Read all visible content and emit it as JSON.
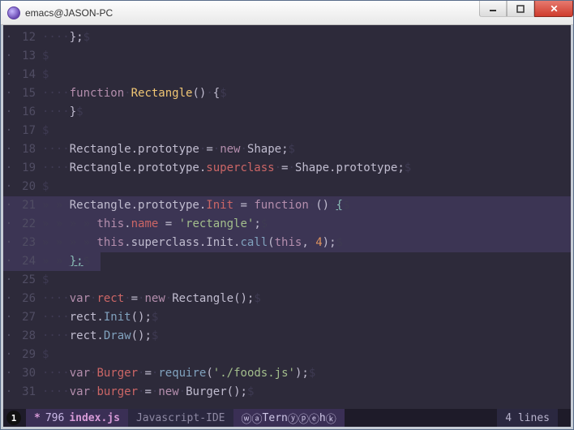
{
  "window": {
    "title": "emacs@JASON-PC"
  },
  "editor": {
    "whitespace_dot": "·",
    "whitespace_tab": "» ",
    "eol_marker": "$",
    "lines": [
      {
        "n": 12,
        "hl": false,
        "tokens": [
          [
            "ws",
            "····"
          ],
          [
            "pun",
            "};"
          ],
          [
            "eol",
            "$"
          ]
        ]
      },
      {
        "n": 13,
        "hl": false,
        "tokens": [
          [
            "eol",
            "$"
          ]
        ]
      },
      {
        "n": 14,
        "hl": false,
        "tokens": [
          [
            "eol",
            "$"
          ]
        ]
      },
      {
        "n": 15,
        "hl": false,
        "tokens": [
          [
            "ws",
            "····"
          ],
          [
            "kw",
            "function"
          ],
          [
            "ws",
            "·"
          ],
          [
            "fn",
            "Rectangle"
          ],
          [
            "pun",
            "()"
          ],
          [
            "ws",
            "·"
          ],
          [
            "pun",
            "{"
          ],
          [
            "eol",
            "$"
          ]
        ]
      },
      {
        "n": 16,
        "hl": false,
        "tokens": [
          [
            "ws",
            "····"
          ],
          [
            "pun",
            "}"
          ],
          [
            "eol",
            "$"
          ]
        ]
      },
      {
        "n": 17,
        "hl": false,
        "tokens": [
          [
            "eol",
            "$"
          ]
        ]
      },
      {
        "n": 18,
        "hl": false,
        "tokens": [
          [
            "ws",
            "····"
          ],
          [
            "id",
            "Rectangle.prototype"
          ],
          [
            "ws",
            "·"
          ],
          [
            "pun",
            "="
          ],
          [
            "ws",
            "·"
          ],
          [
            "kw",
            "new"
          ],
          [
            "ws",
            "·"
          ],
          [
            "id",
            "Shape;"
          ],
          [
            "eol",
            "$"
          ]
        ]
      },
      {
        "n": 19,
        "hl": false,
        "tokens": [
          [
            "ws",
            "····"
          ],
          [
            "id",
            "Rectangle.prototype."
          ],
          [
            "assign-name",
            "superclass"
          ],
          [
            "ws",
            "·"
          ],
          [
            "pun",
            "="
          ],
          [
            "ws",
            "·"
          ],
          [
            "id",
            "Shape.prototype;"
          ],
          [
            "eol",
            "$"
          ]
        ]
      },
      {
        "n": 20,
        "hl": false,
        "tokens": [
          [
            "eol",
            "$"
          ]
        ]
      },
      {
        "n": 21,
        "hl": true,
        "tokens": [
          [
            "ws",
            "» » "
          ],
          [
            "id",
            "Rectangle.prototype."
          ],
          [
            "assign-name",
            "Init"
          ],
          [
            "ws",
            "·"
          ],
          [
            "pun",
            "="
          ],
          [
            "ws",
            "·"
          ],
          [
            "kw",
            "function"
          ],
          [
            "ws",
            "·"
          ],
          [
            "pun",
            "()"
          ],
          [
            "ws",
            "·"
          ],
          [
            "brace-match",
            "{"
          ],
          [
            "eol",
            "$"
          ]
        ]
      },
      {
        "n": 22,
        "hl": true,
        "tokens": [
          [
            "ws",
            "» » » » "
          ],
          [
            "kw",
            "this"
          ],
          [
            "id",
            "."
          ],
          [
            "assign-name",
            "name"
          ],
          [
            "ws",
            "·"
          ],
          [
            "pun",
            "="
          ],
          [
            "ws",
            "·"
          ],
          [
            "str",
            "'rectangle'"
          ],
          [
            "pun",
            ";"
          ],
          [
            "eol",
            "$"
          ]
        ]
      },
      {
        "n": 23,
        "hl": true,
        "tokens": [
          [
            "ws",
            "» » » » "
          ],
          [
            "kw",
            "this"
          ],
          [
            "id",
            ".superclass.Init."
          ],
          [
            "call",
            "call"
          ],
          [
            "pun",
            "("
          ],
          [
            "kw",
            "this"
          ],
          [
            "pun",
            ","
          ],
          [
            "ws",
            "·"
          ],
          [
            "num",
            "4"
          ],
          [
            "pun",
            ");"
          ],
          [
            "eol",
            "$"
          ]
        ]
      },
      {
        "n": 24,
        "hl": "last",
        "tokens": [
          [
            "ws",
            "» » "
          ],
          [
            "brace-match",
            "};"
          ],
          [
            "eol",
            "$"
          ]
        ]
      },
      {
        "n": 25,
        "hl": false,
        "tokens": [
          [
            "eol",
            "$"
          ]
        ]
      },
      {
        "n": 26,
        "hl": false,
        "tokens": [
          [
            "ws",
            "····"
          ],
          [
            "kw",
            "var"
          ],
          [
            "ws",
            "·"
          ],
          [
            "assign-name",
            "rect"
          ],
          [
            "ws",
            "·"
          ],
          [
            "pun",
            "="
          ],
          [
            "ws",
            "·"
          ],
          [
            "kw",
            "new"
          ],
          [
            "ws",
            "·"
          ],
          [
            "id",
            "Rectangle();"
          ],
          [
            "eol",
            "$"
          ]
        ]
      },
      {
        "n": 27,
        "hl": false,
        "tokens": [
          [
            "ws",
            "····"
          ],
          [
            "id",
            "rect."
          ],
          [
            "call",
            "Init"
          ],
          [
            "pun",
            "();"
          ],
          [
            "eol",
            "$"
          ]
        ]
      },
      {
        "n": 28,
        "hl": false,
        "tokens": [
          [
            "ws",
            "····"
          ],
          [
            "id",
            "rect."
          ],
          [
            "call",
            "Draw"
          ],
          [
            "pun",
            "();"
          ],
          [
            "eol",
            "$"
          ]
        ]
      },
      {
        "n": 29,
        "hl": false,
        "tokens": [
          [
            "eol",
            "$"
          ]
        ]
      },
      {
        "n": 30,
        "hl": false,
        "tokens": [
          [
            "ws",
            "····"
          ],
          [
            "kw",
            "var"
          ],
          [
            "ws",
            "·"
          ],
          [
            "assign-name",
            "Burger"
          ],
          [
            "ws",
            "·"
          ],
          [
            "pun",
            "="
          ],
          [
            "ws",
            "·"
          ],
          [
            "call",
            "require"
          ],
          [
            "pun",
            "("
          ],
          [
            "str",
            "'./foods.js'"
          ],
          [
            "pun",
            ");"
          ],
          [
            "eol",
            "$"
          ]
        ]
      },
      {
        "n": 31,
        "hl": false,
        "tokens": [
          [
            "ws",
            "····"
          ],
          [
            "kw",
            "var"
          ],
          [
            "ws",
            "·"
          ],
          [
            "assign-name",
            "burger"
          ],
          [
            "ws",
            "·"
          ],
          [
            "pun",
            "="
          ],
          [
            "ws",
            "·"
          ],
          [
            "kw",
            "new"
          ],
          [
            "ws",
            "·"
          ],
          [
            "id",
            "Burger();"
          ],
          [
            "eol",
            "$"
          ]
        ]
      }
    ]
  },
  "modeline": {
    "window_number": "1",
    "modified_marker": "*",
    "position": "796",
    "filename": "index.js",
    "major_mode": "Javascript-IDE",
    "minor_modes_display": [
      "ⓦ",
      "ⓐ",
      "Tern",
      "ⓨ",
      "ⓟ",
      "ⓔ",
      "h",
      "ⓚ"
    ],
    "region_info": "4 lines"
  }
}
